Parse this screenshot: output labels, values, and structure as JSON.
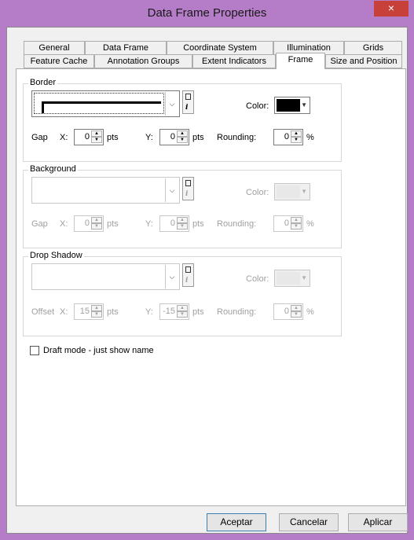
{
  "window": {
    "title": "Data Frame Properties",
    "close_glyph": "×"
  },
  "tabs_row1": [
    "General",
    "Data Frame",
    "Coordinate System",
    "Illumination",
    "Grids"
  ],
  "tabs_row2": [
    "Feature Cache",
    "Annotation Groups",
    "Extent Indicators",
    "Frame",
    "Size and Position"
  ],
  "active_tab": "Frame",
  "border": {
    "legend": "Border",
    "color_label": "Color:",
    "color_value": "#000000",
    "gap_label": "Gap",
    "x_label": "X:",
    "x_value": "0",
    "pts1": "pts",
    "y_label": "Y:",
    "y_value": "0",
    "pts2": "pts",
    "rounding_label": "Rounding:",
    "rounding_value": "0",
    "percent": "%"
  },
  "background": {
    "legend": "Background",
    "color_label": "Color:",
    "gap_label": "Gap",
    "x_label": "X:",
    "x_value": "0",
    "pts1": "pts",
    "y_label": "Y:",
    "y_value": "0",
    "pts2": "pts",
    "rounding_label": "Rounding:",
    "rounding_value": "0",
    "percent": "%"
  },
  "drop_shadow": {
    "legend": "Drop Shadow",
    "color_label": "Color:",
    "offset_label": "Offset",
    "x_label": "X:",
    "x_value": "15",
    "pts1": "pts",
    "y_label": "Y:",
    "y_value": "-15",
    "pts2": "pts",
    "rounding_label": "Rounding:",
    "rounding_value": "0",
    "percent": "%"
  },
  "draft_mode_label": "Draft mode - just show name",
  "buttons": {
    "ok": "Aceptar",
    "cancel": "Cancelar",
    "apply": "Aplicar"
  }
}
